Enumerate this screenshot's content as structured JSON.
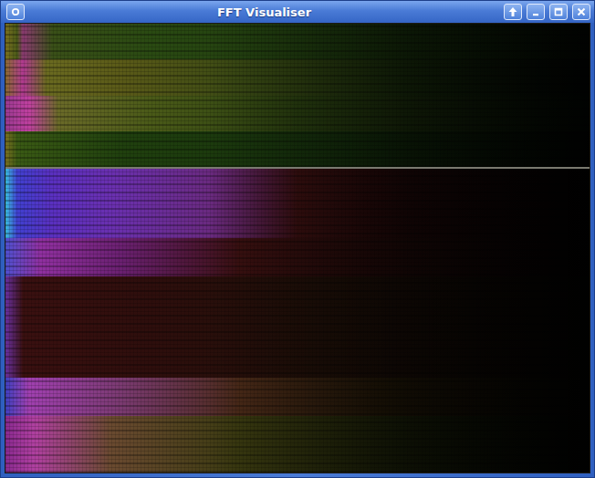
{
  "window": {
    "title": "FFT Visualiser"
  }
}
